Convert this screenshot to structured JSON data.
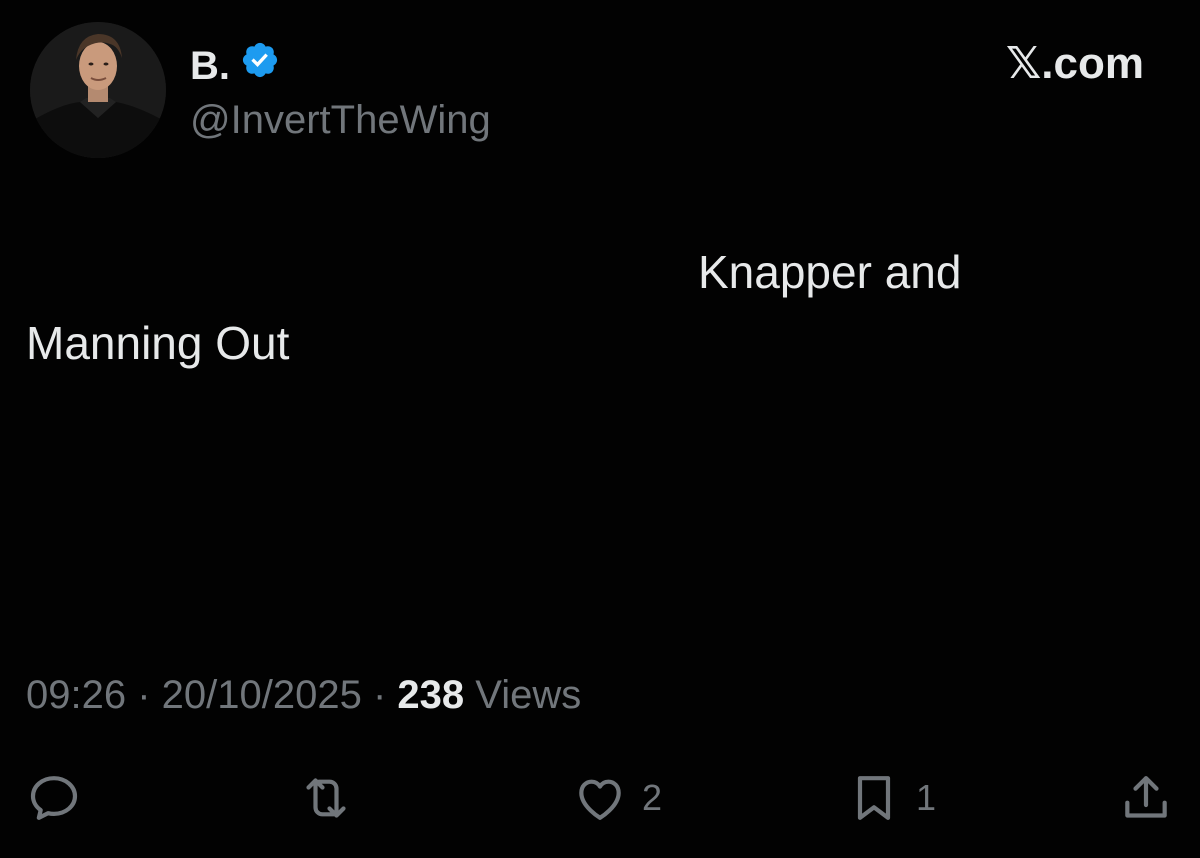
{
  "author": {
    "display_name": "B.",
    "handle": "@InvertTheWing",
    "verified": true,
    "verified_color": "#1d9bf0"
  },
  "site_mark": "𝕏.com",
  "tweet": {
    "line1": "Knapper and",
    "line2": "Manning Out"
  },
  "meta": {
    "time": "09:26",
    "date": "20/10/2025",
    "views_count": "238",
    "views_label": "Views"
  },
  "actions": {
    "reply_icon": "reply-icon",
    "retweet_icon": "retweet-icon",
    "like_icon": "heart-icon",
    "like_count": "2",
    "bookmark_icon": "bookmark-icon",
    "bookmark_count": "1",
    "share_icon": "share-icon"
  },
  "colors": {
    "background": "#020202",
    "text": "#e7e9ea",
    "secondary": "#71767b"
  }
}
